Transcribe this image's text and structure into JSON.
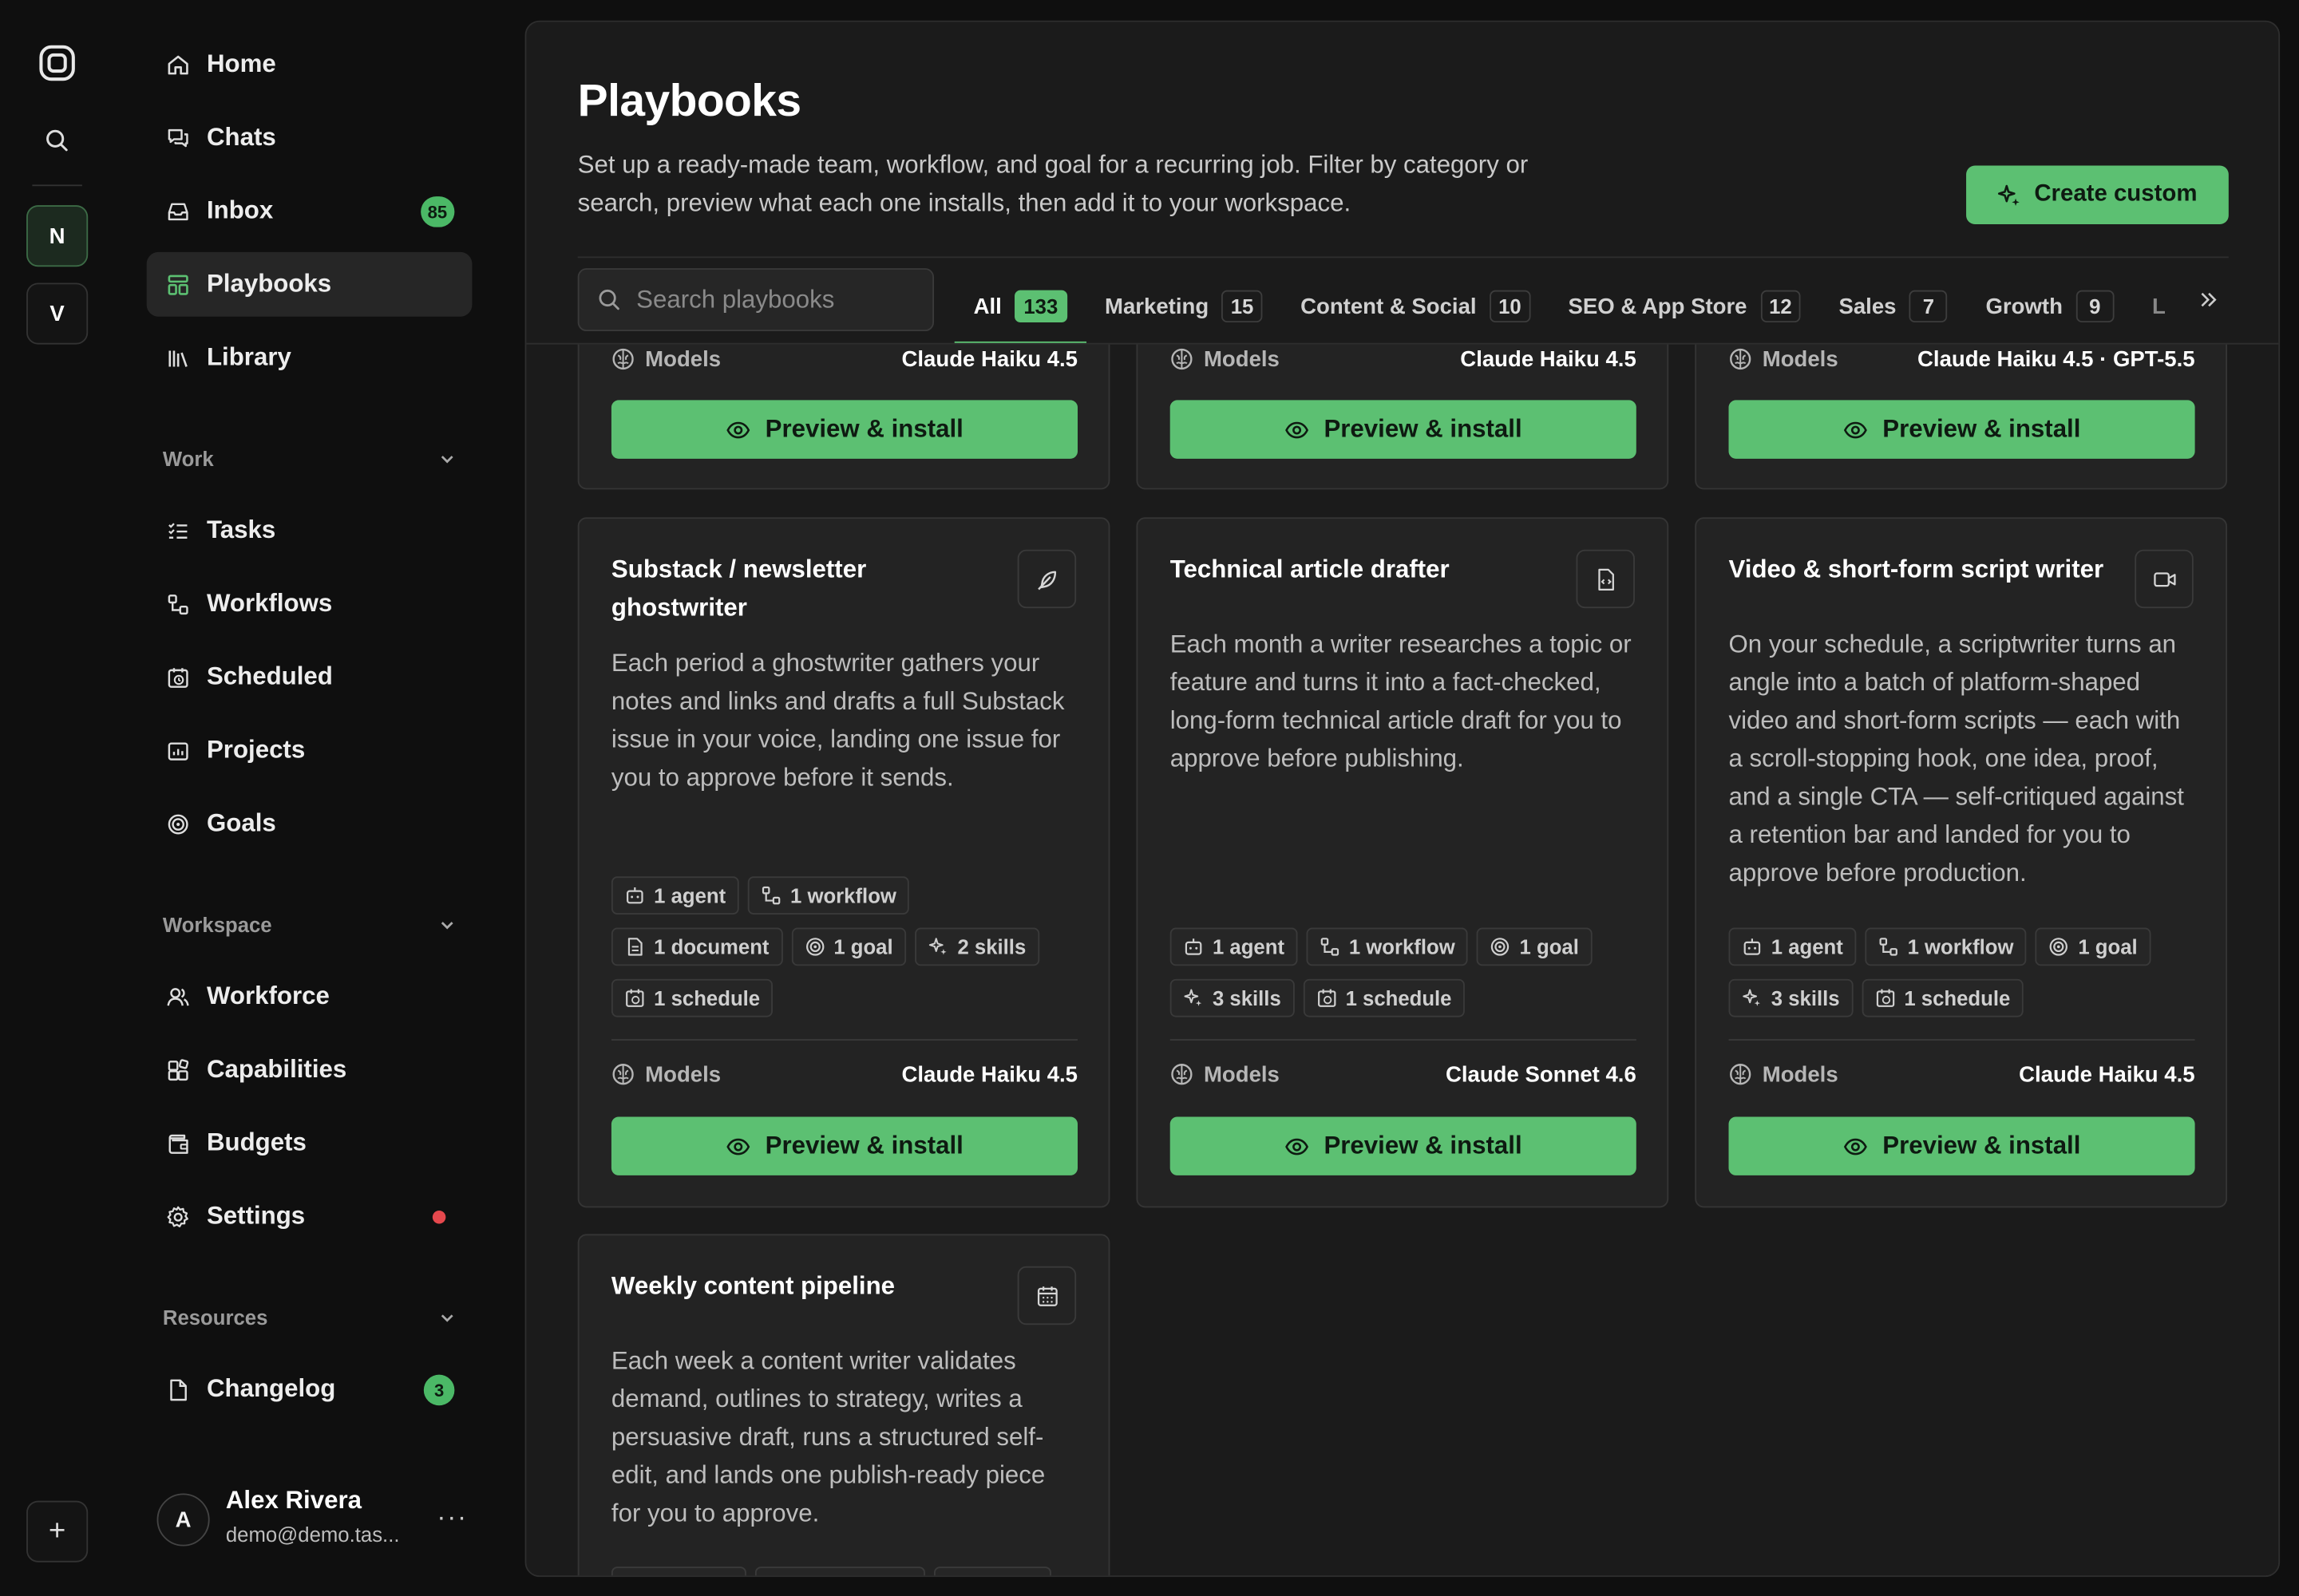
{
  "rail": {
    "workspaces": [
      "N",
      "V"
    ],
    "add_label": "+"
  },
  "sidebar": {
    "top_items": [
      {
        "label": "Home",
        "icon": "home-icon"
      },
      {
        "label": "Chats",
        "icon": "chats-icon"
      },
      {
        "label": "Inbox",
        "icon": "inbox-icon",
        "badge": "85"
      },
      {
        "label": "Playbooks",
        "icon": "playbooks-icon",
        "active": true
      },
      {
        "label": "Library",
        "icon": "library-icon"
      }
    ],
    "sections": [
      {
        "title": "Work",
        "items": [
          {
            "label": "Tasks",
            "icon": "tasks-icon"
          },
          {
            "label": "Workflows",
            "icon": "workflows-icon"
          },
          {
            "label": "Scheduled",
            "icon": "scheduled-icon"
          },
          {
            "label": "Projects",
            "icon": "projects-icon"
          },
          {
            "label": "Goals",
            "icon": "goals-icon"
          }
        ]
      },
      {
        "title": "Workspace",
        "items": [
          {
            "label": "Workforce",
            "icon": "workforce-icon"
          },
          {
            "label": "Capabilities",
            "icon": "capabilities-icon"
          },
          {
            "label": "Budgets",
            "icon": "budgets-icon"
          },
          {
            "label": "Settings",
            "icon": "settings-icon",
            "dot": true
          }
        ]
      },
      {
        "title": "Resources",
        "items": [
          {
            "label": "Changelog",
            "icon": "changelog-icon",
            "badge": "3"
          }
        ]
      }
    ],
    "user": {
      "initial": "A",
      "name": "Alex Rivera",
      "email": "demo@demo.tas...",
      "more": "···"
    }
  },
  "main": {
    "title": "Playbooks",
    "description": "Set up a ready-made team, workflow, and goal for a recurring job. Filter by category or search, preview what each one installs, then add it to your workspace.",
    "create_label": "Create custom",
    "search_placeholder": "Search playbooks",
    "tabs": [
      {
        "label": "All",
        "count": "133",
        "active": true
      },
      {
        "label": "Marketing",
        "count": "15"
      },
      {
        "label": "Content & Social",
        "count": "10"
      },
      {
        "label": "SEO & App Store",
        "count": "12"
      },
      {
        "label": "Sales",
        "count": "7"
      },
      {
        "label": "Growth",
        "count": "9"
      },
      {
        "label": "L",
        "count": ""
      }
    ],
    "models_label": "Models",
    "install_label": "Preview & install",
    "partial_cards": [
      {
        "models": "Claude Haiku 4.5"
      },
      {
        "models": "Claude Haiku 4.5"
      },
      {
        "models": "Claude Haiku 4.5 · GPT-5.5"
      }
    ],
    "cards": [
      {
        "title": "Substack / newsletter ghostwriter",
        "icon": "feather-icon",
        "description": "Each period a ghostwriter gathers your notes and links and drafts a full Substack issue in your voice, landing one issue for you to approve before it sends.",
        "chips": [
          {
            "label": "1 agent",
            "icon": "agent-icon"
          },
          {
            "label": "1 workflow",
            "icon": "workflow-icon"
          },
          {
            "label": "1 document",
            "icon": "document-icon"
          },
          {
            "label": "1 goal",
            "icon": "goal-icon"
          },
          {
            "label": "2 skills",
            "icon": "skills-icon"
          },
          {
            "label": "1 schedule",
            "icon": "schedule-icon"
          }
        ],
        "models": "Claude Haiku 4.5"
      },
      {
        "title": "Technical article drafter",
        "icon": "code-file-icon",
        "description": "Each month a writer researches a topic or feature and turns it into a fact-checked, long-form technical article draft for you to approve before publishing.",
        "chips": [
          {
            "label": "1 agent",
            "icon": "agent-icon"
          },
          {
            "label": "1 workflow",
            "icon": "workflow-icon"
          },
          {
            "label": "1 goal",
            "icon": "goal-icon"
          },
          {
            "label": "3 skills",
            "icon": "skills-icon"
          },
          {
            "label": "1 schedule",
            "icon": "schedule-icon"
          }
        ],
        "models": "Claude Sonnet 4.6"
      },
      {
        "title": "Video & short-form script writer",
        "icon": "video-icon",
        "description": "On your schedule, a scriptwriter turns an angle into a batch of platform-shaped video and short-form scripts — each with a scroll-stopping hook, one idea, proof, and a single CTA — self-critiqued against a retention bar and landed for you to approve before production.",
        "chips": [
          {
            "label": "1 agent",
            "icon": "agent-icon"
          },
          {
            "label": "1 workflow",
            "icon": "workflow-icon"
          },
          {
            "label": "1 goal",
            "icon": "goal-icon"
          },
          {
            "label": "3 skills",
            "icon": "skills-icon"
          },
          {
            "label": "1 schedule",
            "icon": "schedule-icon"
          }
        ],
        "models": "Claude Haiku 4.5"
      },
      {
        "title": "Weekly content pipeline",
        "icon": "calendar-icon",
        "description": "Each week a content writer validates demand, outlines to strategy, writes a persuasive draft, runs a structured self-edit, and lands one publish-ready piece for you to approve."
      }
    ]
  }
}
